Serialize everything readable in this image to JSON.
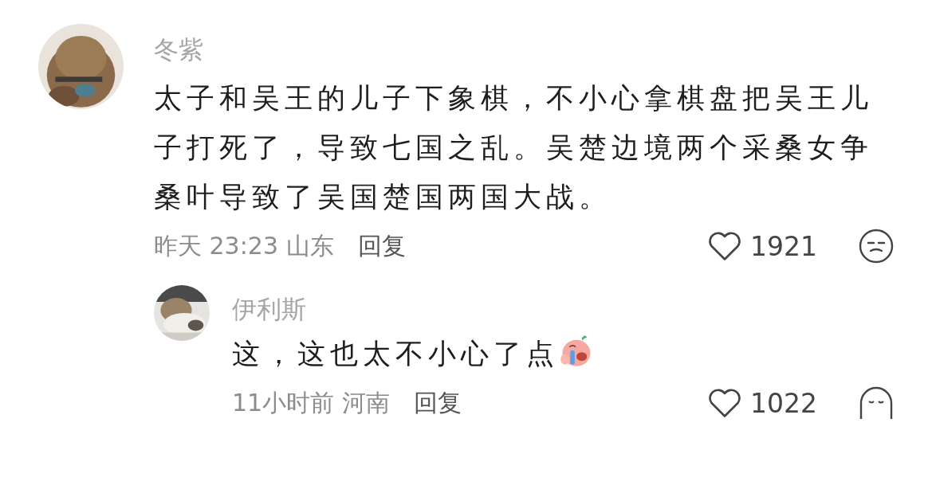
{
  "comments": [
    {
      "author": "冬紫",
      "text": "太子和吴王的儿子下象棋，不小心拿棋盘把吴王儿子打死了，导致七国之乱。吴楚边境两个采桑女争桑叶导致了吴国楚国两国大战。",
      "time": "昨天 23:23 山东",
      "reply": "回复",
      "likes": "1921",
      "liked": false,
      "reaction": {
        "kind": "frown"
      }
    },
    {
      "author": "伊利斯",
      "text": "这，这也太不小心了点",
      "emoji": {
        "kind": "crying"
      },
      "time": "11小时前 河南",
      "reply": "回复",
      "likes": "1022",
      "liked": false,
      "reaction": {
        "kind": "sleepy"
      }
    }
  ]
}
